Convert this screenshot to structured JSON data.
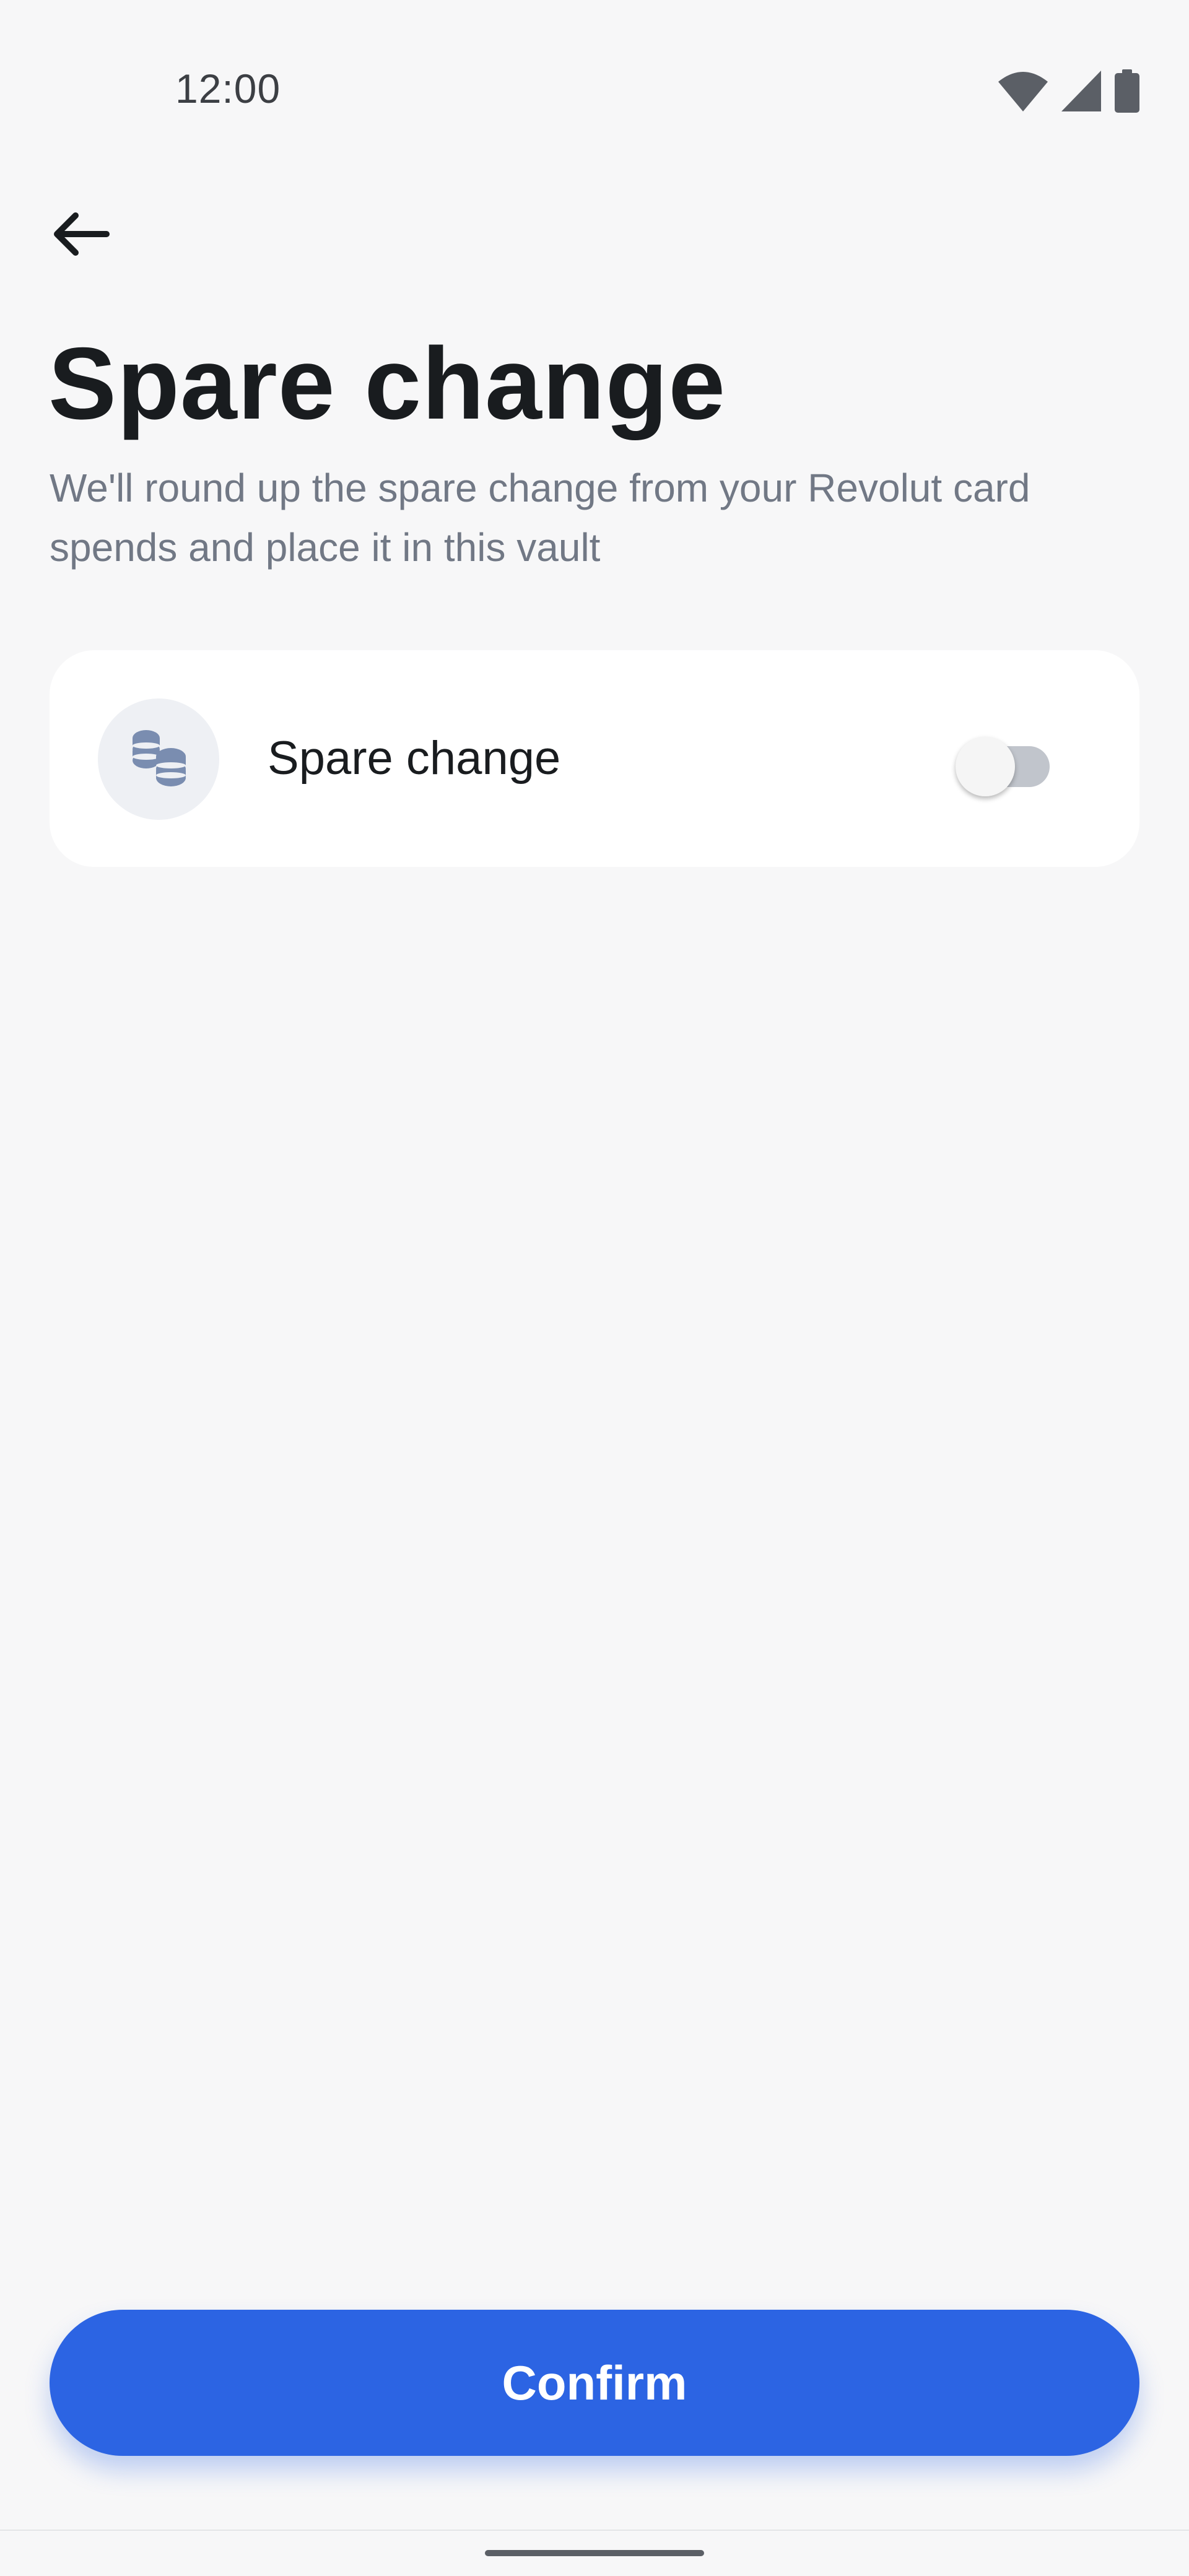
{
  "status_bar": {
    "time": "12:00",
    "icons": [
      "wifi-icon",
      "cellular-signal-icon",
      "battery-icon"
    ]
  },
  "header": {
    "back_icon": "arrow-left-icon",
    "title": "Spare change",
    "subtitle": "We'll round up the spare change from your Revolut card spends and place it in this vault"
  },
  "setting": {
    "icon": "coins-icon",
    "label": "Spare change",
    "enabled": false
  },
  "actions": {
    "confirm_label": "Confirm"
  },
  "colors": {
    "background": "#f7f7f8",
    "card": "#ffffff",
    "accent": "#2c64e3",
    "subtitle_text": "#717885",
    "toggle_off_track": "#c1c5cc",
    "coin_icon": "#7a8db0"
  }
}
